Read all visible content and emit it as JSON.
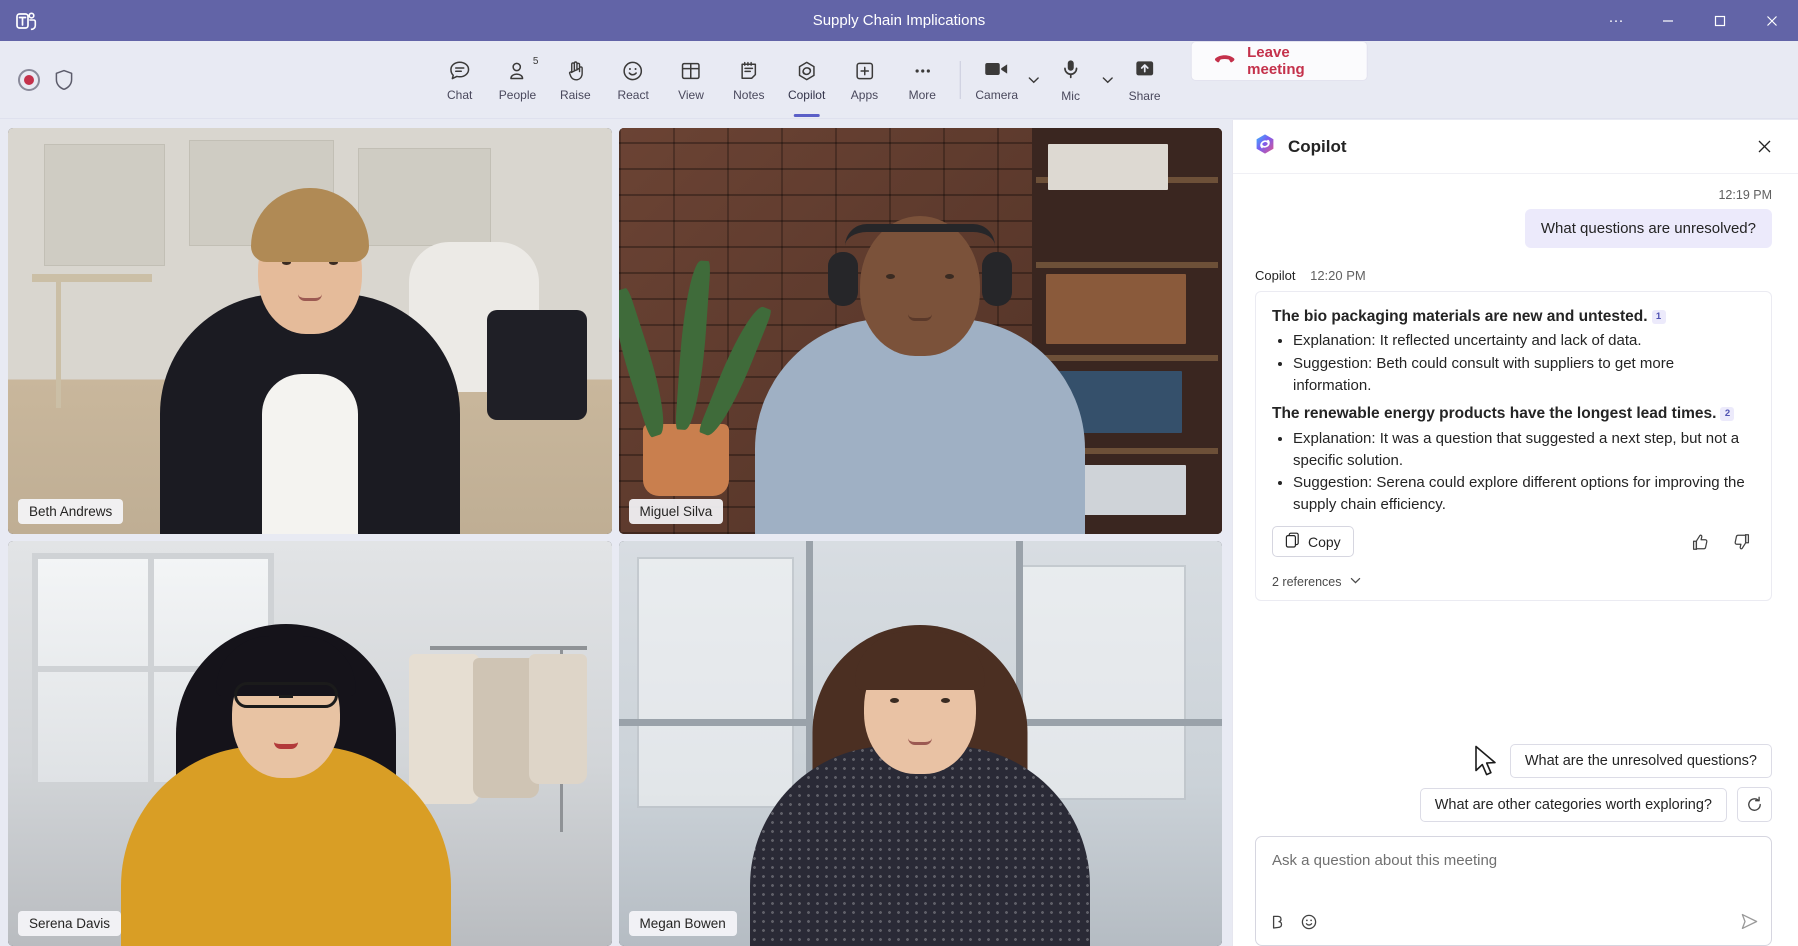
{
  "window": {
    "title": "Supply Chain Implications",
    "app_icon": "teams-logo-icon",
    "more_label": "···",
    "minimize_label": "–",
    "maximize_label": "❐",
    "close_label": "✕"
  },
  "toolbar": {
    "recording_icon": "recording-indicator-icon",
    "shield_icon": "shield-icon",
    "items": [
      {
        "id": "chat",
        "label": "Chat",
        "icon": "chat-icon",
        "badge": "",
        "active": false
      },
      {
        "id": "people",
        "label": "People",
        "icon": "people-icon",
        "badge": "5",
        "active": false
      },
      {
        "id": "raise",
        "label": "Raise",
        "icon": "raise-hand-icon",
        "badge": "",
        "active": false
      },
      {
        "id": "react",
        "label": "React",
        "icon": "react-smiley-icon",
        "badge": "",
        "active": false
      },
      {
        "id": "view",
        "label": "View",
        "icon": "view-grid-icon",
        "badge": "",
        "active": false
      },
      {
        "id": "notes",
        "label": "Notes",
        "icon": "notes-icon",
        "badge": "",
        "active": false
      },
      {
        "id": "copilot",
        "label": "Copilot",
        "icon": "copilot-icon",
        "badge": "",
        "active": true
      },
      {
        "id": "apps",
        "label": "Apps",
        "icon": "apps-plus-icon",
        "badge": "",
        "active": false
      },
      {
        "id": "more",
        "label": "More",
        "icon": "more-ellipsis-icon",
        "badge": "",
        "active": false
      }
    ],
    "camera_label": "Camera",
    "mic_label": "Mic",
    "share_label": "Share",
    "leave_label": "Leave meeting",
    "leave_color": "#c4314b"
  },
  "stage": {
    "participants": [
      {
        "name": "Beth Andrews"
      },
      {
        "name": "Miguel Silva"
      },
      {
        "name": "Serena Davis"
      },
      {
        "name": "Megan Bowen"
      }
    ]
  },
  "copilot": {
    "title": "Copilot",
    "close_icon": "close-icon",
    "user_message": {
      "time": "12:19 PM",
      "text": "What questions are unresolved?"
    },
    "response": {
      "author": "Copilot",
      "time": "12:20 PM",
      "blocks": [
        {
          "heading": "The bio packaging materials are new and untested.",
          "citation": "1",
          "bullets": [
            "Explanation: It reflected uncertainty and lack of data.",
            "Suggestion: Beth could consult with suppliers to get more information."
          ]
        },
        {
          "heading": "The renewable energy products have the longest lead times.",
          "citation": "2",
          "bullets": [
            "Explanation: It was a question that suggested a next step, but not a specific solution.",
            "Suggestion: Serena could explore different options for improving the supply chain efficiency."
          ]
        }
      ],
      "copy_label": "Copy",
      "thumbs_up_icon": "thumbs-up-icon",
      "thumbs_down_icon": "thumbs-down-icon",
      "references_label": "2 references"
    },
    "suggestions": [
      "What are the unresolved questions?",
      "What are other categories worth exploring?"
    ],
    "refresh_icon": "refresh-icon",
    "composer": {
      "placeholder": "Ask a question about this meeting",
      "tool_icons": [
        "bold-format-icon",
        "emoji-icon"
      ],
      "send_icon": "send-icon"
    }
  },
  "colors": {
    "titlebar": "#6264a7",
    "accent": "#5b5fc7",
    "stage_bg": "#e8eaf3",
    "panel_bg": "#ffffff",
    "user_bubble": "#eceafb"
  }
}
